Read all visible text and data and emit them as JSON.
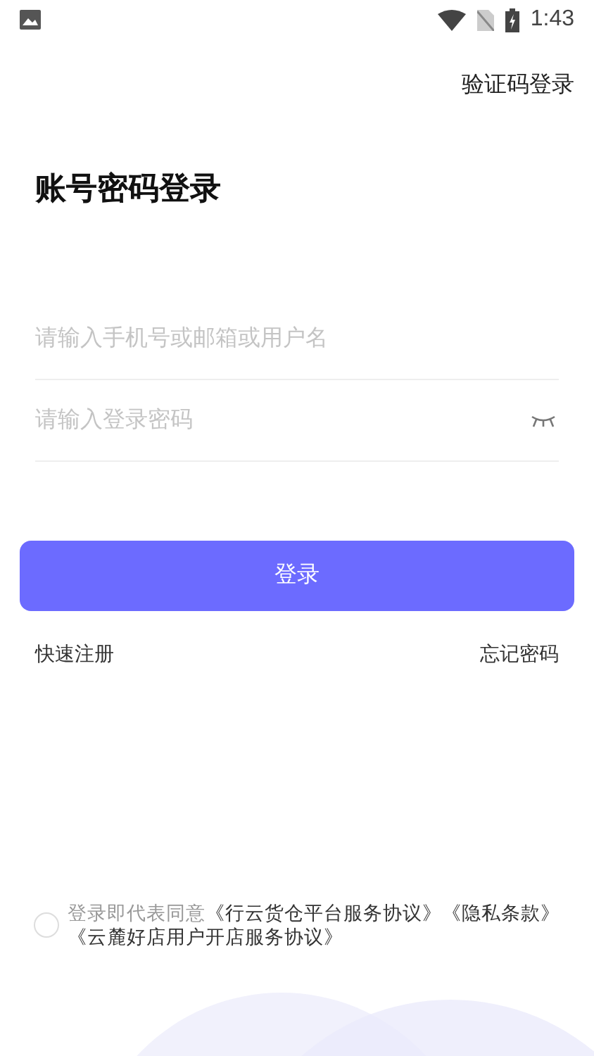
{
  "status_bar": {
    "time": "1:43"
  },
  "top_link": "验证码登录",
  "title": "账号密码登录",
  "fields": [
    {
      "kind": "text",
      "placeholder": "请输入手机号或邮箱或用户名"
    },
    {
      "kind": "password",
      "placeholder": "请输入登录密码"
    }
  ],
  "login_button": "登录",
  "links": [
    "快速注册",
    "忘记密码"
  ],
  "agreement": {
    "checked": false,
    "prefix": "登录即代表同意",
    "documents": [
      "《行云货仓平台服务协议》",
      "《隐私条款》",
      "《云麓好店用户开店服务协议》"
    ]
  }
}
